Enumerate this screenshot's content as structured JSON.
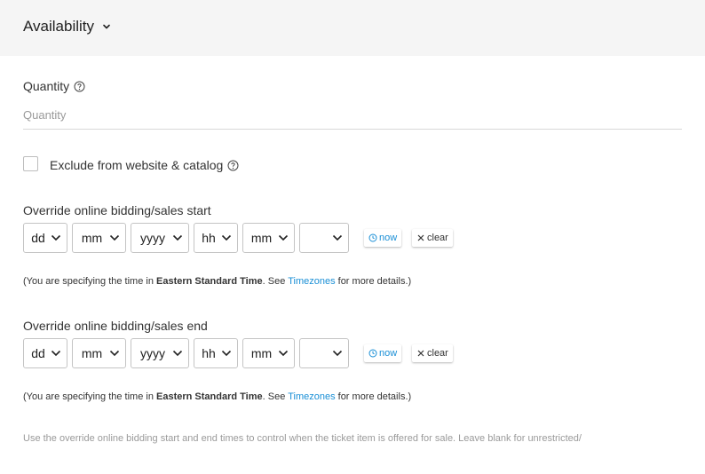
{
  "section": {
    "title": "Availability"
  },
  "quantity": {
    "label": "Quantity",
    "placeholder": "Quantity",
    "value": ""
  },
  "exclude": {
    "label": "Exclude from website & catalog",
    "checked": false
  },
  "start": {
    "label": "Override online bidding/sales start",
    "selects": {
      "day": "dd",
      "month": "mm",
      "year": "yyyy",
      "hour": "hh",
      "minute": "mm",
      "ampm": ""
    },
    "now_label": "now",
    "clear_label": "clear",
    "note": {
      "prefix": "(You are specifying the time in ",
      "timezone": "Eastern Standard Time",
      "middle": ". See ",
      "link": "Timezones",
      "suffix": " for more details.)"
    }
  },
  "end": {
    "label": "Override online bidding/sales end",
    "selects": {
      "day": "dd",
      "month": "mm",
      "year": "yyyy",
      "hour": "hh",
      "minute": "mm",
      "ampm": ""
    },
    "now_label": "now",
    "clear_label": "clear",
    "note": {
      "prefix": "(You are specifying the time in ",
      "timezone": "Eastern Standard Time",
      "middle": ". See ",
      "link": "Timezones",
      "suffix": " for more details.)"
    }
  },
  "footer_hint": "Use the override online bidding start and end times to control when the ticket item is offered for sale. Leave blank for unrestricted/",
  "colors": {
    "link": "#1a8fd6",
    "header_bg": "#f5f5f5",
    "hint": "#9a9a9a"
  },
  "icons": {
    "section_toggle": "chevron-down-icon",
    "help": "question-circle-icon",
    "now": "clock-icon",
    "clear": "x-icon",
    "select": "caret-down-icon"
  }
}
